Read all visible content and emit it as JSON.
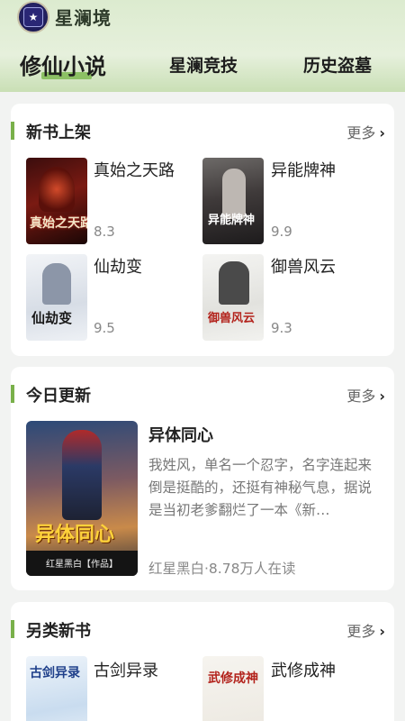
{
  "app": {
    "title": "星澜境",
    "logo_icon": "star-logo-icon"
  },
  "tabs": [
    {
      "label": "修仙小说",
      "active": true
    },
    {
      "label": "星澜竞技",
      "active": false
    },
    {
      "label": "历史盗墓",
      "active": false
    }
  ],
  "sections": {
    "new_books": {
      "title": "新书上架",
      "more": "更多",
      "books": [
        {
          "name": "真始之天路",
          "score": "8.3",
          "cover_text": "真始之天路"
        },
        {
          "name": "异能牌神",
          "score": "9.9",
          "cover_text": "异能牌神"
        },
        {
          "name": "仙劫变",
          "score": "9.5",
          "cover_text": "仙劫变"
        },
        {
          "name": "御兽风云",
          "score": "9.3",
          "cover_text": "御兽风云"
        }
      ]
    },
    "today_update": {
      "title": "今日更新",
      "more": "更多",
      "book": {
        "name": "异体同心",
        "description": "我姓风，单名一个忍字，名字连起来倒是挺酷的，还挺有神秘气息，据说是当初老爹翻烂了一本《新…",
        "meta": "红星黑白·8.78万人在读",
        "cover_text": "异体同心",
        "cover_author": "红星黑白【作品】"
      }
    },
    "alt_new": {
      "title": "另类新书",
      "more": "更多",
      "books": [
        {
          "name": "古剑异录",
          "cover_text": "古剑异录"
        },
        {
          "name": "武修成神",
          "cover_text": "武修成神"
        }
      ]
    }
  },
  "colors": {
    "accent": "#79b04a",
    "tab_highlight": "#8cc064"
  }
}
